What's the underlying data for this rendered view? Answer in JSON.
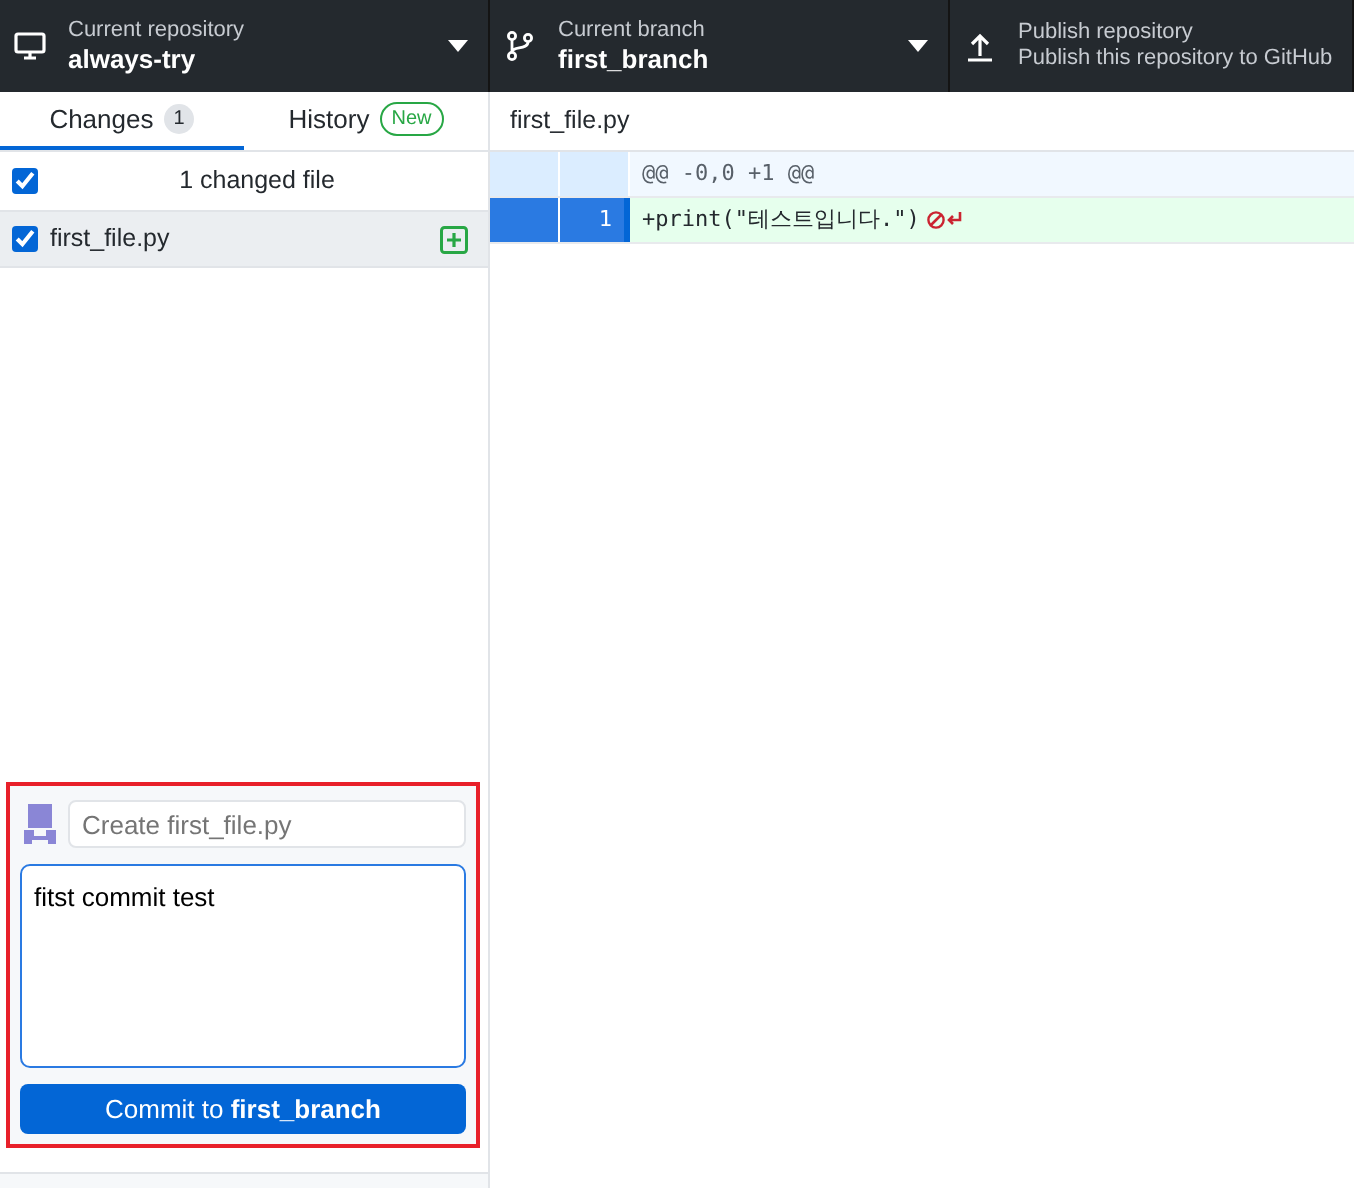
{
  "toolbar": [
    {
      "kind": "repo",
      "label": "Current repository",
      "value": "always-try"
    },
    {
      "kind": "branch",
      "label": "Current branch",
      "value": "first_branch"
    },
    {
      "kind": "publish",
      "label": "Publish repository",
      "value": "Publish this repository to GitHub"
    }
  ],
  "tabs": [
    {
      "label": "Changes",
      "badge": "1",
      "kind": "count",
      "selected": true
    },
    {
      "label": "History",
      "badge": "New",
      "kind": "new",
      "selected": false
    }
  ],
  "changes": {
    "summary": "1 changed file",
    "all_checked": true,
    "files": [
      {
        "name": "first_file.py",
        "checked": true,
        "selected": true,
        "kind": "added"
      }
    ]
  },
  "commit": {
    "summary_placeholder": "Create first_file.py",
    "description": "fitst commit test",
    "button": "Commit to **first_branch**",
    "highlighted": true
  },
  "diff": {
    "file": "first_file.py",
    "hunk": "@@ -0,0 +1 @@",
    "lines": [
      {
        "new_number": "1",
        "text": "+print(\"테스트입니다.\")",
        "selected": true,
        "no_newline": true
      }
    ]
  }
}
